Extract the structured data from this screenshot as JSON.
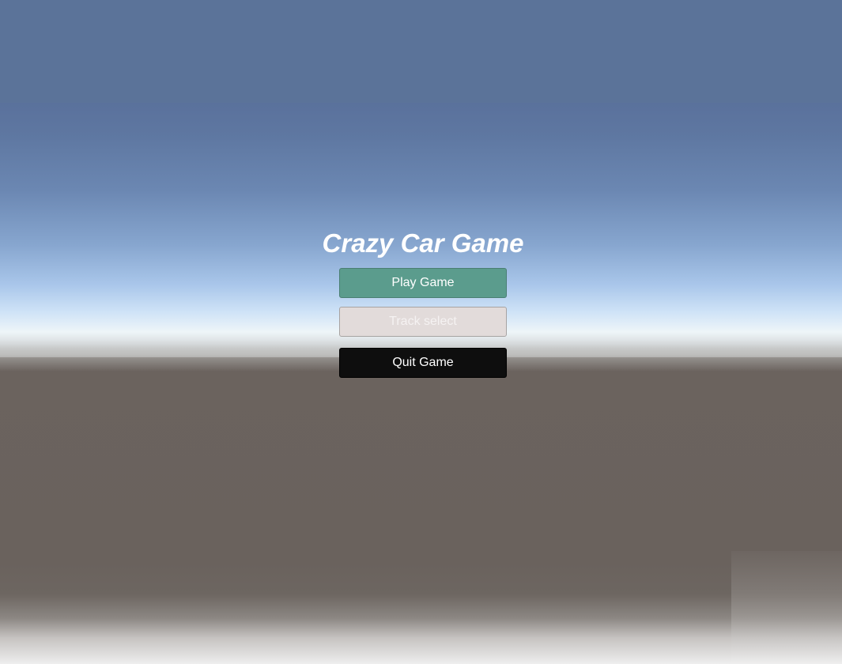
{
  "game": {
    "title": "Crazy Car Game"
  },
  "menu": {
    "buttons": [
      {
        "label": "Play Game",
        "color": "#5b9c8d"
      },
      {
        "label": "Track select",
        "color": "#e2dbda"
      },
      {
        "label": "Quit Game",
        "color": "#0e0e0e"
      }
    ]
  },
  "colors": {
    "sky": "#5b7399",
    "horizon": "#eef5f8",
    "ground": "#6b635e"
  }
}
